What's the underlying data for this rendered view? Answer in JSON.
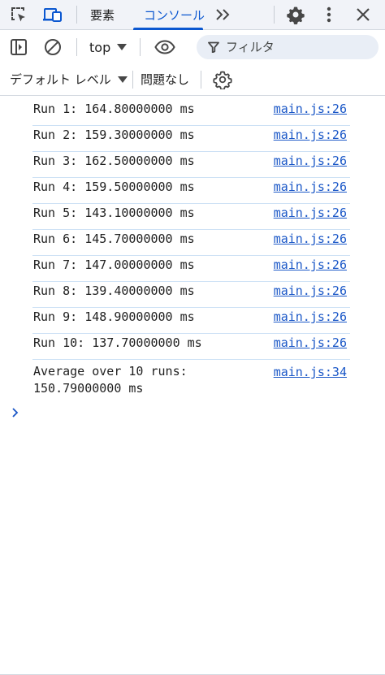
{
  "tabs": {
    "elements_label": "要素",
    "console_label": "コンソール"
  },
  "toolbar": {
    "context_label": "top",
    "filter_placeholder": "フィルタ",
    "levels_label": "デフォルト レベル",
    "issues_label": "問題なし"
  },
  "console": {
    "messages": [
      {
        "text": "Run 1: 164.80000000 ms",
        "source": "main.js:26"
      },
      {
        "text": "Run 2: 159.30000000 ms",
        "source": "main.js:26"
      },
      {
        "text": "Run 3: 162.50000000 ms",
        "source": "main.js:26"
      },
      {
        "text": "Run 4: 159.50000000 ms",
        "source": "main.js:26"
      },
      {
        "text": "Run 5: 143.10000000 ms",
        "source": "main.js:26"
      },
      {
        "text": "Run 6: 145.70000000 ms",
        "source": "main.js:26"
      },
      {
        "text": "Run 7: 147.00000000 ms",
        "source": "main.js:26"
      },
      {
        "text": "Run 8: 139.40000000 ms",
        "source": "main.js:26"
      },
      {
        "text": "Run 9: 148.90000000 ms",
        "source": "main.js:26"
      },
      {
        "text": "Run 10: 137.70000000 ms",
        "source": "main.js:26"
      },
      {
        "text": "Average over 10 runs:\n150.79000000 ms",
        "source": "main.js:34"
      }
    ]
  },
  "icons": {
    "inspect": "inspect-element-icon",
    "device": "device-toolbar-icon",
    "more_tabs": "chevron-double-right-icon",
    "settings": "gear-icon",
    "menu": "kebab-menu-icon",
    "close": "close-icon",
    "sidebar": "sidebar-toggle-icon",
    "clear": "clear-console-icon",
    "eye": "eye-icon",
    "filter": "filter-icon",
    "console_settings": "console-settings-gear-icon",
    "prompt": "prompt-chevron-icon"
  },
  "colors": {
    "accent": "#0b57d0",
    "link": "#1a57c7",
    "row_border": "#cde1f5"
  }
}
